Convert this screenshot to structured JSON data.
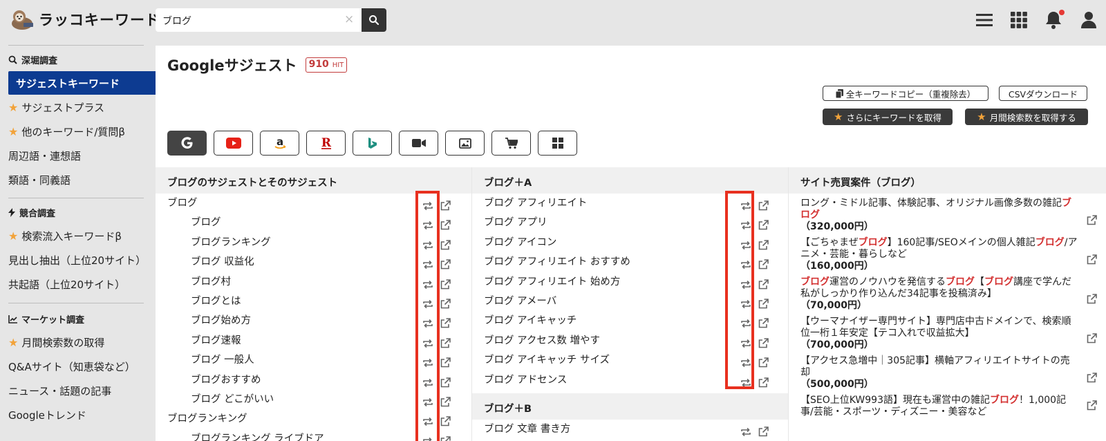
{
  "app": {
    "name": "ラッコキーワード"
  },
  "search": {
    "value": "ブログ",
    "clear_label": "×"
  },
  "sidebar": {
    "sections": [
      {
        "label": "深堀調査",
        "icon": "search-icon"
      },
      {
        "label": "競合調査",
        "icon": "lightning-icon"
      },
      {
        "label": "マーケット調査",
        "icon": "chart-icon"
      }
    ],
    "items": [
      {
        "label": "サジェストキーワード",
        "active": true,
        "star": false
      },
      {
        "label": "サジェストプラス",
        "star": true
      },
      {
        "label": "他のキーワード/質問β",
        "star": true
      },
      {
        "label": "周辺語・連想語",
        "star": false
      },
      {
        "label": "類語・同義語",
        "star": false
      },
      {
        "label": "検索流入キーワードβ",
        "star": true
      },
      {
        "label": "見出し抽出（上位20サイト）",
        "star": false
      },
      {
        "label": "共起語（上位20サイト）",
        "star": false
      },
      {
        "label": "月間検索数の取得",
        "star": true
      },
      {
        "label": "Q&Aサイト（知恵袋など）",
        "star": false
      },
      {
        "label": "ニュース・話題の記事",
        "star": false
      },
      {
        "label": "Googleトレンド",
        "star": false
      }
    ]
  },
  "main": {
    "title": "Googleサジェスト",
    "hit_count": "910",
    "hit_unit": "HIT",
    "copy_all_label": "全キーワードコピー（重複除去）",
    "csv_label": "CSVダウンロード",
    "more_keywords_label": "さらにキーワードを取得",
    "monthly_volume_label": "月間検索数を取得する",
    "engines": [
      "google",
      "youtube",
      "amazon",
      "rakuten",
      "bing",
      "video",
      "image",
      "shopping",
      "apps"
    ]
  },
  "columns": {
    "col1": {
      "header": "ブログのサジェストとそのサジェスト",
      "rows": [
        {
          "text": "ブログ",
          "indent": false
        },
        {
          "text": "ブログ",
          "indent": true
        },
        {
          "text": "ブログランキング",
          "indent": true
        },
        {
          "text": "ブログ 収益化",
          "indent": true
        },
        {
          "text": "ブログ村",
          "indent": true
        },
        {
          "text": "ブログとは",
          "indent": true
        },
        {
          "text": "ブログ始め方",
          "indent": true
        },
        {
          "text": "ブログ速報",
          "indent": true
        },
        {
          "text": "ブログ 一般人",
          "indent": true
        },
        {
          "text": "ブログおすすめ",
          "indent": true
        },
        {
          "text": "ブログ どこがいい",
          "indent": true
        },
        {
          "text": "ブログランキング",
          "indent": false
        },
        {
          "text": "ブログランキング ライブドア",
          "indent": true
        }
      ]
    },
    "col2": {
      "header": "ブログ＋A",
      "rows": [
        "ブログ アフィリエイト",
        "ブログ アプリ",
        "ブログ アイコン",
        "ブログ アフィリエイト おすすめ",
        "ブログ アフィリエイト 始め方",
        "ブログ アメーバ",
        "ブログ アイキャッチ",
        "ブログ アクセス数 増やす",
        "ブログ アイキャッチ サイズ",
        "ブログ アドセンス"
      ],
      "header_b": "ブログ＋B",
      "rows_b": [
        "ブログ 文章 書き方"
      ]
    },
    "col3": {
      "header": "サイト売買案件（ブログ）",
      "items": [
        {
          "segments": [
            {
              "t": "ロング・ミドル記事、体験記事、オリジナル画像多数の雑記",
              "hl": false
            },
            {
              "t": "ブログ",
              "hl": true
            }
          ],
          "price": "（320,000円）"
        },
        {
          "segments": [
            {
              "t": "【ごちゃまぜ",
              "hl": false
            },
            {
              "t": "ブログ",
              "hl": true
            },
            {
              "t": "】160記事/SEOメインの個人雑記",
              "hl": false
            },
            {
              "t": "ブログ",
              "hl": true
            },
            {
              "t": "/アニメ・芸能・暮らしなど",
              "hl": false
            }
          ],
          "price": "（160,000円）"
        },
        {
          "segments": [
            {
              "t": "ブログ",
              "hl": true
            },
            {
              "t": "運営のノウハウを発信する",
              "hl": false
            },
            {
              "t": "ブログ",
              "hl": true
            },
            {
              "t": "【",
              "hl": false
            },
            {
              "t": "ブログ",
              "hl": true
            },
            {
              "t": "講座で学んだ私がしっかり作り込んだ34記事を投稿済み】",
              "hl": false
            }
          ],
          "price": "（70,000円）"
        },
        {
          "segments": [
            {
              "t": "【ウーマナイザー専門サイト】専門店中古ドメインで、検索順位一桁１年安定【テコ入れで収益拡大】",
              "hl": false
            }
          ],
          "price": "（700,000円）"
        },
        {
          "segments": [
            {
              "t": "【アクセス急増中｜305記事】横軸アフィリエイトサイトの売却",
              "hl": false
            }
          ],
          "price": "（500,000円）"
        },
        {
          "segments": [
            {
              "t": "【SEO上位KW993語】現在も運営中の雑記",
              "hl": false
            },
            {
              "t": "ブログ",
              "hl": true
            },
            {
              "t": "！1,000記事/芸能・スポーツ・ディズニー・美容など",
              "hl": false
            }
          ],
          "price": ""
        }
      ]
    }
  }
}
